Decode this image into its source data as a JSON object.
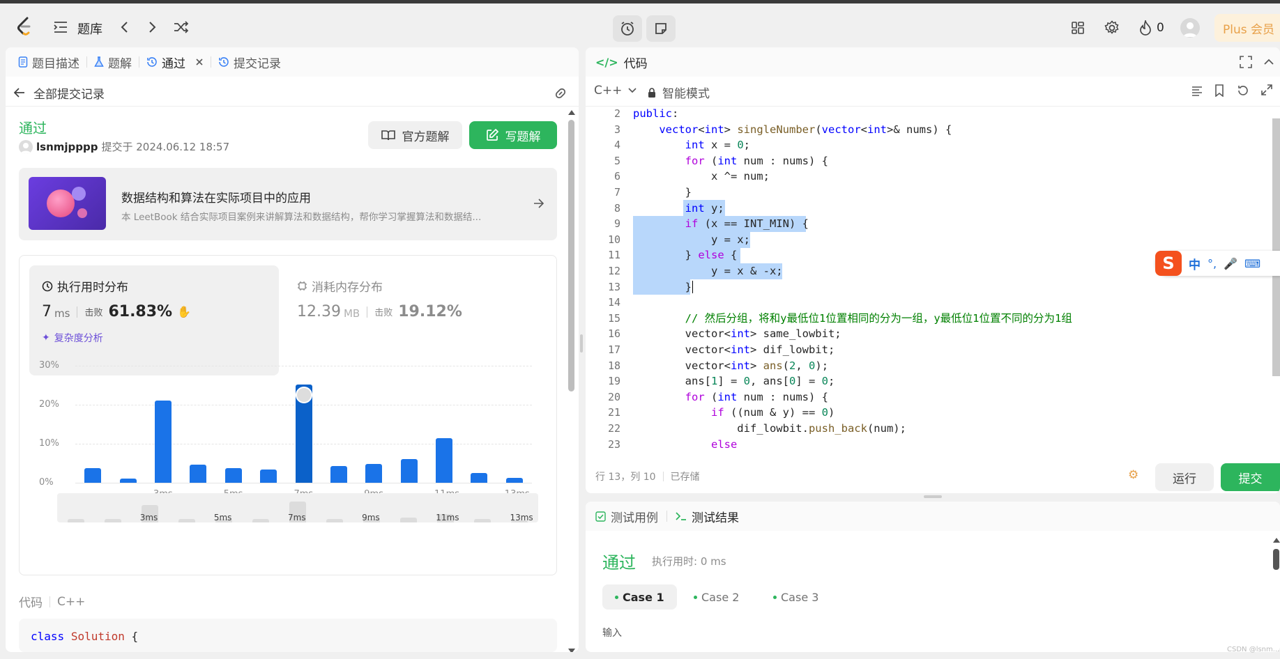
{
  "topbar": {
    "problem_bank_label": "题库",
    "streak_count": "0",
    "plus_label": "Plus 会员",
    "icons": [
      "leetcode-logo-icon",
      "list-icon",
      "chevron-left-icon",
      "chevron-right-icon",
      "shuffle-icon",
      "alarm-icon",
      "note-icon",
      "layout-icon",
      "gear-icon",
      "fire-icon",
      "avatar-icon"
    ]
  },
  "left_tabs": [
    {
      "label": "题目描述",
      "icon": "document-icon"
    },
    {
      "label": "题解",
      "icon": "flask-icon"
    },
    {
      "label": "通过",
      "icon": "history-icon"
    },
    {
      "label": "提交记录",
      "icon": "history-icon"
    }
  ],
  "submission": {
    "back_label": "全部提交记录",
    "status": "通过",
    "username": "lsnmjpppp",
    "submitted_at": "提交于 2024.06.12 18:57",
    "official_solution_label": "官方题解",
    "write_solution_label": "写题解"
  },
  "promo": {
    "title": "数据结构和算法在实际项目中的应用",
    "subtitle": "本 LeetBook 结合实际项目案例来讲解算法和数据结构，帮你学习掌握算法和数据结..."
  },
  "stats": {
    "runtime_label": "执行用时分布",
    "runtime_value": "7",
    "runtime_unit": "ms",
    "beats_label": "击败",
    "runtime_beats": "61.83%",
    "complexity_label": "复杂度分析",
    "memory_label": "消耗内存分布",
    "memory_value": "12.39",
    "memory_unit": "MB",
    "memory_beats": "19.12%"
  },
  "chart_data": {
    "type": "bar",
    "y_ticks": [
      "30%",
      "20%",
      "10%",
      "0%"
    ],
    "ylim": [
      0,
      30
    ],
    "x_ticks": [
      "3ms",
      "5ms",
      "7ms",
      "9ms",
      "11ms",
      "13ms"
    ],
    "values": [
      3.8,
      1,
      21,
      4.6,
      3.8,
      3.4,
      25,
      4.2,
      4.8,
      6.1,
      11.3,
      2.5,
      1.3
    ],
    "highlight_index": 6,
    "colors": {
      "bar": "#1a73e8",
      "highlight": "#0b61c9"
    },
    "mini_values": [
      1,
      1,
      5,
      1,
      1,
      1,
      6,
      1,
      1,
      1.5,
      2.5,
      1,
      0.6
    ]
  },
  "code_section": {
    "label": "代码",
    "lang": "C++",
    "first_line": "class Solution {"
  },
  "editor": {
    "title": "代码",
    "lang": "C++",
    "mode": "智能模式",
    "status_pos": "行 13，列 10",
    "status_saved": "已存储",
    "run_label": "运行",
    "submit_label": "提交",
    "line_numbers": [
      "2",
      "3",
      "4",
      "5",
      "6",
      "7",
      "8",
      "9",
      "10",
      "11",
      "12",
      "13",
      "14",
      "15",
      "16",
      "17",
      "18",
      "19",
      "20",
      "21",
      "22",
      "23"
    ]
  },
  "ime": {
    "label": "中"
  },
  "bottom_panel": {
    "tab_testcase": "测试用例",
    "tab_result": "测试结果",
    "status": "通过",
    "runtime": "执行用时: 0 ms",
    "cases": [
      "Case 1",
      "Case 2",
      "Case 3"
    ],
    "input_label": "输入"
  },
  "watermark": "CSDN @lsnm..."
}
